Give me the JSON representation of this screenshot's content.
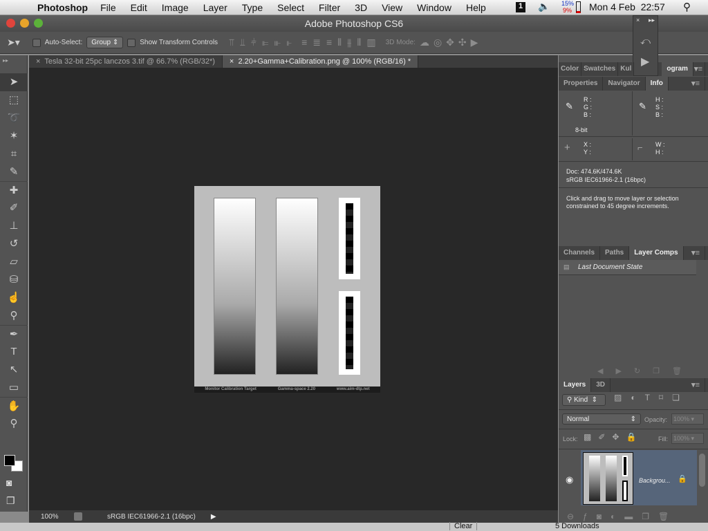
{
  "menubar": {
    "app": "Photoshop",
    "items": [
      "File",
      "Edit",
      "Image",
      "Layer",
      "Type",
      "Select",
      "Filter",
      "3D",
      "View",
      "Window",
      "Help"
    ],
    "battery_top": "15%",
    "battery_bottom": "9%",
    "clock": "Mon 4 Feb  22:57"
  },
  "window": {
    "title": "Adobe Photoshop CS6"
  },
  "options": {
    "auto_select": "Auto-Select:",
    "auto_select_value": "Group",
    "show_transform": "Show Transform Controls",
    "mode_3d": "3D Mode:"
  },
  "tabs": [
    {
      "label": "Tesla 32-bit 25pc lanczos 3.tif @ 66.7% (RGB/32*)",
      "close": "×"
    },
    {
      "label": "2.20+Gamma+Calibration.png @ 100% (RGB/16) *",
      "close": "×"
    }
  ],
  "tools": [
    {
      "name": "move",
      "g": "➤"
    },
    {
      "name": "marquee",
      "g": "⬚"
    },
    {
      "name": "lasso",
      "g": "➰"
    },
    {
      "name": "magic-wand",
      "g": "✶"
    },
    {
      "name": "crop",
      "g": "⌗"
    },
    {
      "name": "eyedropper",
      "g": "✎"
    },
    {
      "name": "healing",
      "g": "✚"
    },
    {
      "name": "brush",
      "g": "✐"
    },
    {
      "name": "stamp",
      "g": "⊥"
    },
    {
      "name": "history-brush",
      "g": "↺"
    },
    {
      "name": "eraser",
      "g": "▱"
    },
    {
      "name": "paint-bucket",
      "g": "⛁"
    },
    {
      "name": "smudge",
      "g": "☝"
    },
    {
      "name": "dodge",
      "g": "⚲"
    },
    {
      "name": "pen",
      "g": "✒"
    },
    {
      "name": "type",
      "g": "T"
    },
    {
      "name": "path-select",
      "g": "↖"
    },
    {
      "name": "rectangle",
      "g": "▭"
    },
    {
      "name": "hand",
      "g": "✋"
    },
    {
      "name": "zoom",
      "g": "⚲"
    }
  ],
  "document": {
    "footer": [
      "Monitor Calibration Target",
      "Gamma-space 2.20",
      "www.aim-dtp.net"
    ]
  },
  "status": {
    "zoom": "100%",
    "profile": "sRGB IEC61966-2.1 (16bpc)"
  },
  "panels": {
    "top_tabs": [
      "Color",
      "Swatches",
      "Kul",
      "ogram"
    ],
    "info_tabs": [
      "Properties",
      "Navigator",
      "Info"
    ],
    "info": {
      "r": "R :",
      "g": "G :",
      "b": "B :",
      "h": "H :",
      "s": "S :",
      "b2": "B :",
      "bit": "8-bit",
      "x": "X :",
      "y": "Y :",
      "w": "W :",
      "hh": "H :",
      "doc": "Doc: 474.6K/474.6K",
      "profile": "sRGB IEC61966-2.1 (16bpc)",
      "hint": "Click and drag to move layer or selection constrained to 45 degree increments."
    },
    "comps_tabs": [
      "Channels",
      "Paths",
      "Layer Comps"
    ],
    "comp_item": "Last Document State",
    "layers_tabs": [
      "Layers",
      "3D"
    ],
    "kind": "Kind",
    "blend": "Normal",
    "opacity_label": "Opacity:",
    "opacity": "100%",
    "lock_label": "Lock:",
    "fill_label": "Fill:",
    "fill": "100%",
    "layer_name": "Backgrou..."
  },
  "bottom": {
    "clear": "Clear",
    "downloads": "5 Downloads"
  }
}
